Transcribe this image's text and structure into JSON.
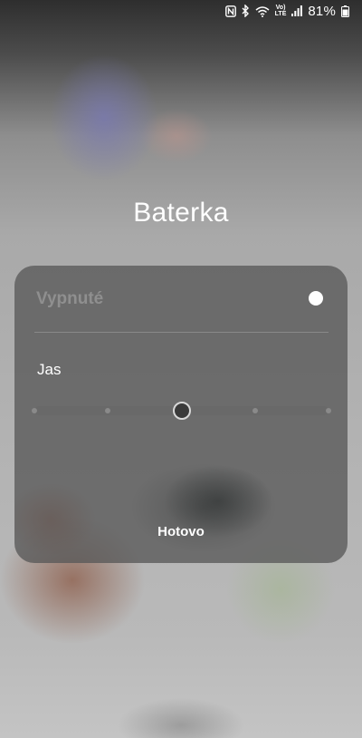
{
  "status_bar": {
    "icons": [
      "nfc-icon",
      "bluetooth-icon",
      "wifi-icon",
      "volte-icon",
      "signal-icon",
      "battery-icon"
    ],
    "volte_top": "Vo)",
    "volte_bottom": "LTE",
    "battery_percent": "81%"
  },
  "title": "Baterka",
  "panel": {
    "toggle_label": "Vypnuté",
    "toggle_on": false,
    "brightness_label": "Jas",
    "brightness_steps": 5,
    "brightness_level": 3,
    "done_label": "Hotovo"
  },
  "colors": {
    "panel_bg": "#585858",
    "text_primary": "#ffffff",
    "text_disabled": "#8f8f8f"
  }
}
